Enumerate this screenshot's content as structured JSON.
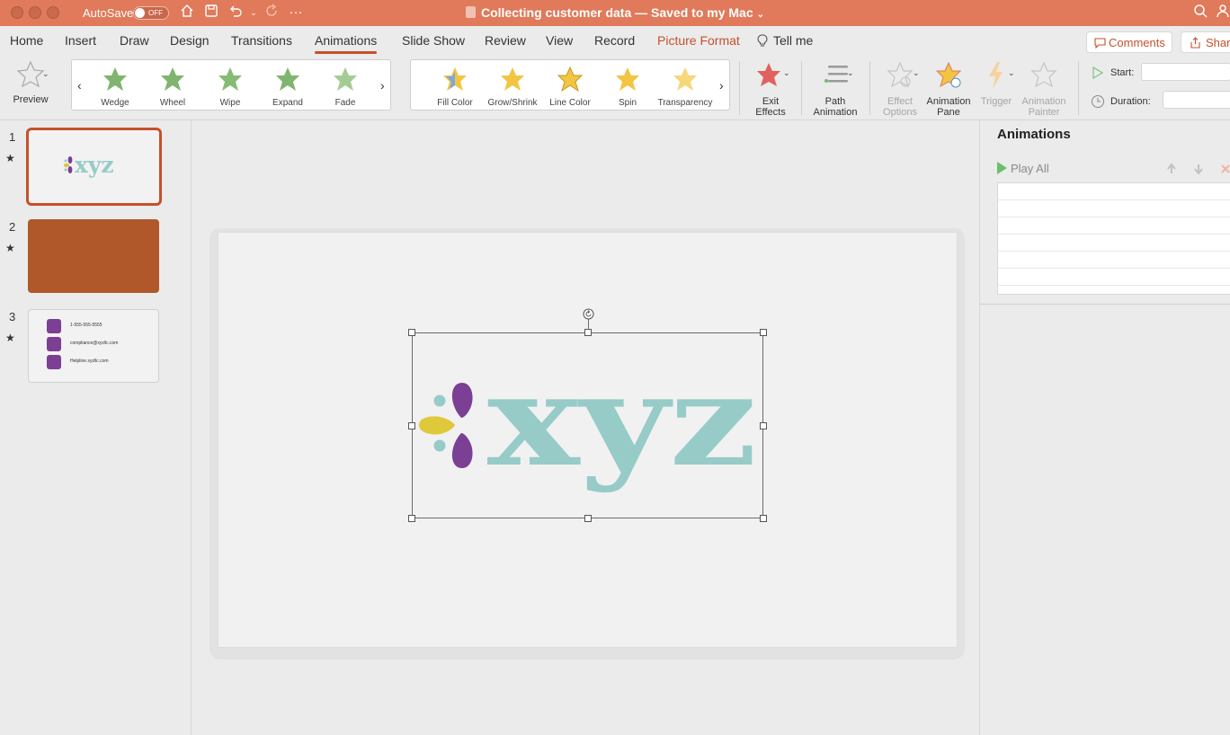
{
  "titlebar": {
    "autosave_label": "AutoSave",
    "autosave_state": "OFF",
    "document_title": "Collecting customer data — Saved to my Mac",
    "icons": [
      "close-dot-icon",
      "minimize-dot-icon",
      "zoom-dot-icon",
      "home-icon",
      "save-icon",
      "undo-icon",
      "redo-icon",
      "more-icon",
      "search-icon",
      "account-icon"
    ]
  },
  "menu": {
    "tabs": [
      "Home",
      "Insert",
      "Draw",
      "Design",
      "Transitions",
      "Animations",
      "Slide Show",
      "Review",
      "View",
      "Record",
      "Picture Format"
    ],
    "active_tab": "Animations",
    "tell_me": "Tell me",
    "comments_label": "Comments",
    "share_label": "Share"
  },
  "ribbon": {
    "preview_label": "Preview",
    "entrance_effects": [
      "Wedge",
      "Wheel",
      "Wipe",
      "Expand",
      "Fade"
    ],
    "emphasis_effects": [
      "Fill Color",
      "Grow/Shrink",
      "Line Color",
      "Spin",
      "Transparency"
    ],
    "exit_effects": "Exit Effects",
    "exit_effects_lines": [
      "Exit",
      "Effects"
    ],
    "path_animation": "Path Animation",
    "path_animation_lines": [
      "Path",
      "Animation"
    ],
    "effect_options": "Effect Options",
    "effect_options_lines": [
      "Effect",
      "Options"
    ],
    "animation_pane": "Animation Pane",
    "animation_pane_lines": [
      "Animation",
      "Pane"
    ],
    "trigger": "Trigger",
    "animation_painter": "Animation Painter",
    "animation_painter_lines": [
      "Animation",
      "Painter"
    ],
    "start_label": "Start:",
    "duration_label": "Duration:",
    "colors": {
      "entrance_star": "#7fb56f",
      "emphasis_star": "#f2c542",
      "exit_star": "#e0625e"
    }
  },
  "thumbnails": {
    "slides": [
      {
        "number": "1",
        "has_animation": true,
        "logo_text": "xyz"
      },
      {
        "number": "2",
        "has_animation": true,
        "fill": "#b1582a"
      },
      {
        "number": "3",
        "has_animation": true,
        "contacts": [
          "1-555-555-5555",
          "compliance@xyzllc.com",
          "Helpline.xyzllc.com"
        ]
      }
    ],
    "star_glyph": "★"
  },
  "slide": {
    "logo_text": "xyz",
    "logo_color": "#96cbc8",
    "petal_colors": {
      "purple": "#7b3f94",
      "yellow": "#dfc93a",
      "teal": "#96cbc8"
    }
  },
  "animation_pane": {
    "title": "Animations",
    "play_all": "Play All"
  }
}
